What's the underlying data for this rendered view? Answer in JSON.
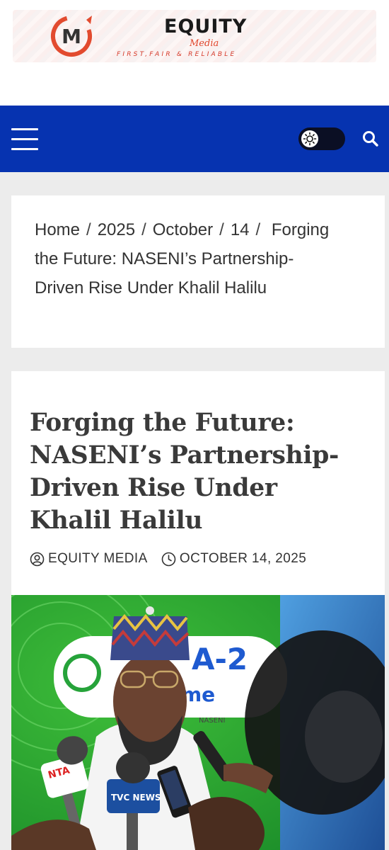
{
  "header": {
    "brand_name": "EQUITY",
    "brand_sub": "Media",
    "tagline": "FIRST,FAIR & RELIABLE",
    "logo_letter": "M",
    "logo_colors": {
      "red": "#e24b2f",
      "dark": "#333333"
    }
  },
  "nav": {
    "menu_icon": "hamburger-icon",
    "theme_icon": "sun-icon",
    "search_icon": "search-icon",
    "background": "#0633b0"
  },
  "breadcrumb": {
    "items": [
      "Home",
      "2025",
      "October",
      "14"
    ],
    "current": "Forging the Future: NASENI’s Partnership-Driven Rise Under Khalil Halilu",
    "separator": "/"
  },
  "article": {
    "title": "Forging the Future: NASENI’s Partnership-Driven Rise Under Khalil Halilu",
    "author": "EQUITY MEDIA",
    "date": "OCTOBER 14, 2025",
    "author_icon": "user-icon",
    "date_icon": "clock-icon"
  },
  "hero_image": {
    "backdrop_text": "A-2",
    "backdrop_sub": "me",
    "backdrop_small": "NASENI",
    "mic_labels": [
      "NTA",
      "TVC NEWS"
    ]
  }
}
